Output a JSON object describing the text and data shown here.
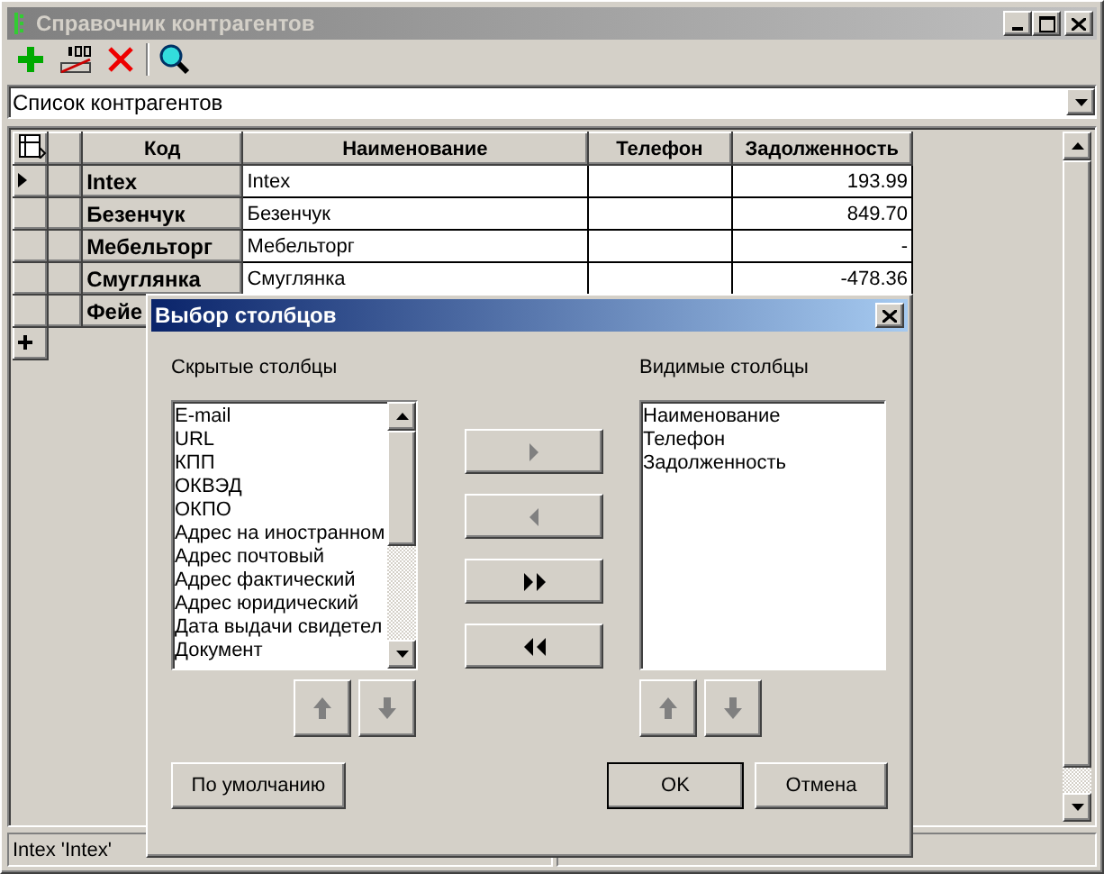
{
  "window": {
    "title": "Справочник контрагентов"
  },
  "filter": {
    "value": "Список контрагентов"
  },
  "grid": {
    "columns": [
      "Код",
      "Наименование",
      "Телефон",
      "Задолженность"
    ],
    "rows": [
      {
        "code": "Intex",
        "name": "Intex",
        "debt": "193.99",
        "selected": true
      },
      {
        "code": "Безенчук",
        "name": "Безенчук",
        "debt": "849.70",
        "selected": false
      },
      {
        "code": "Мебельторг",
        "name": "Мебельторг",
        "debt": "-",
        "selected": false
      },
      {
        "code": "Смуглянка",
        "name": "Смуглянка",
        "debt": "-478.36",
        "selected": false
      },
      {
        "code": "Фейе",
        "selected": false
      }
    ]
  },
  "status_bar": [
    "Intex 'Intex'"
  ],
  "dialog": {
    "title": "Выбор столбцов",
    "hidden_label": "Скрытые столбцы",
    "hidden_columns": [
      "E-mail",
      "URL",
      "КПП",
      "ОКВЭД",
      "ОКПО",
      "Адрес на иностранном",
      "Адрес почтовый",
      "Адрес фактический",
      "Адрес юридический",
      "Дата выдачи свидетел",
      "Документ"
    ],
    "visible_label": "Видимые столбцы",
    "visible_columns": [
      "Наименование",
      "Телефон",
      "Задолженность"
    ],
    "move_buttons": [
      {
        "kind": "add",
        "disabled": true
      },
      {
        "kind": "remove",
        "disabled": true
      },
      {
        "kind": "add_all",
        "disabled": false
      },
      {
        "kind": "remove_all",
        "disabled": false
      }
    ],
    "hidden_order_buttons": [
      {
        "kind": "up",
        "disabled": true
      },
      {
        "kind": "down",
        "disabled": true
      }
    ],
    "visible_order_buttons": [
      {
        "kind": "up",
        "disabled": true
      },
      {
        "kind": "down",
        "disabled": true
      }
    ],
    "default_button": "По умолчанию",
    "ok_button": "OK",
    "cancel_button": "Отмена"
  }
}
